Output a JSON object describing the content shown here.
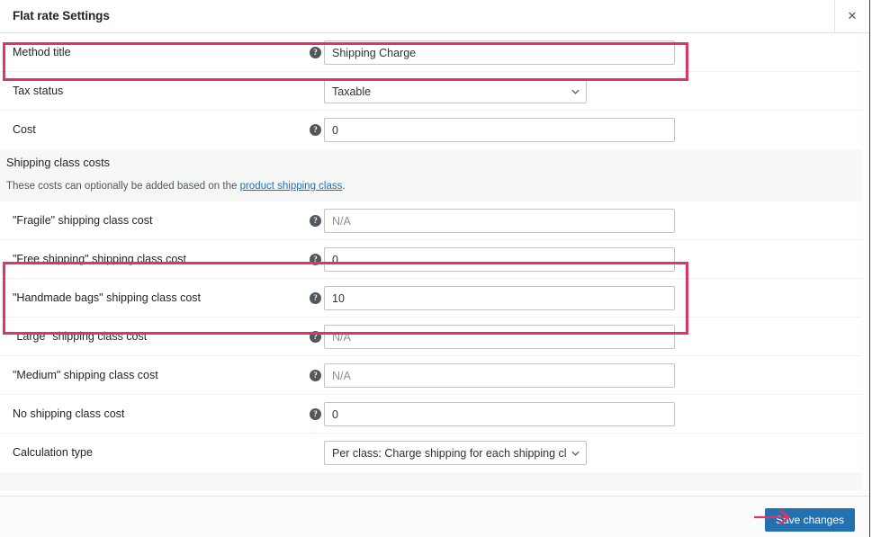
{
  "window": {
    "title": "Flat rate Settings",
    "close_label": "✕"
  },
  "settings_rows": [
    {
      "name": "method-title",
      "label": "Method title",
      "help_icon": "help-icon",
      "field_type": "text",
      "value": "Shipping Charge",
      "placeholder": ""
    },
    {
      "name": "tax-status",
      "label": "Tax status",
      "help_icon": "",
      "field_type": "select",
      "value": "Taxable",
      "placeholder": ""
    },
    {
      "name": "cost",
      "label": "Cost",
      "help_icon": "help-icon",
      "field_type": "text",
      "value": "0",
      "placeholder": ""
    }
  ],
  "section": {
    "title": "Shipping class costs",
    "description_prefix": "These costs can optionally be added based on the ",
    "description_link": "product shipping class",
    "description_suffix": "."
  },
  "class_rows": [
    {
      "name": "fragile-shipping-class-cost",
      "label": "\"Fragile\" shipping class cost",
      "help_icon": "help-icon",
      "field_type": "text",
      "value": "",
      "placeholder": "N/A"
    },
    {
      "name": "free-shipping-shipping-class-cost",
      "label": "\"Free shipping\" shipping class cost",
      "help_icon": "help-icon",
      "field_type": "text",
      "value": "0",
      "placeholder": "N/A"
    },
    {
      "name": "handmade-bags-shipping-class-cost",
      "label": "\"Handmade bags\" shipping class cost",
      "help_icon": "help-icon",
      "field_type": "text",
      "value": "10",
      "placeholder": "N/A"
    },
    {
      "name": "large-shipping-class-cost",
      "label": "\"Large\" shipping class cost",
      "help_icon": "help-icon",
      "field_type": "text",
      "value": "",
      "placeholder": "N/A"
    },
    {
      "name": "medium-shipping-class-cost",
      "label": "\"Medium\" shipping class cost",
      "help_icon": "help-icon",
      "field_type": "text",
      "value": "",
      "placeholder": "N/A"
    },
    {
      "name": "no-shipping-class-cost",
      "label": "No shipping class cost",
      "help_icon": "help-icon",
      "field_type": "text",
      "value": "0",
      "placeholder": "N/A"
    },
    {
      "name": "calculation-type",
      "label": "Calculation type",
      "help_icon": "",
      "field_type": "select",
      "value": "Per class: Charge shipping for each shipping class individual",
      "placeholder": ""
    }
  ],
  "footer": {
    "save_label": "Save changes"
  },
  "annotations": {
    "highlight_color": "#e03563",
    "arrow_color": "#e03563",
    "boxes": [
      {
        "name": "highlight-method-title-row"
      },
      {
        "name": "highlight-shipping-class-cost-rows"
      }
    ],
    "arrow": {
      "name": "arrow-to-save-changes"
    }
  },
  "colors": {
    "accent_button": "#2271b1",
    "link": "#2271b1",
    "annotation": "#e03563"
  }
}
